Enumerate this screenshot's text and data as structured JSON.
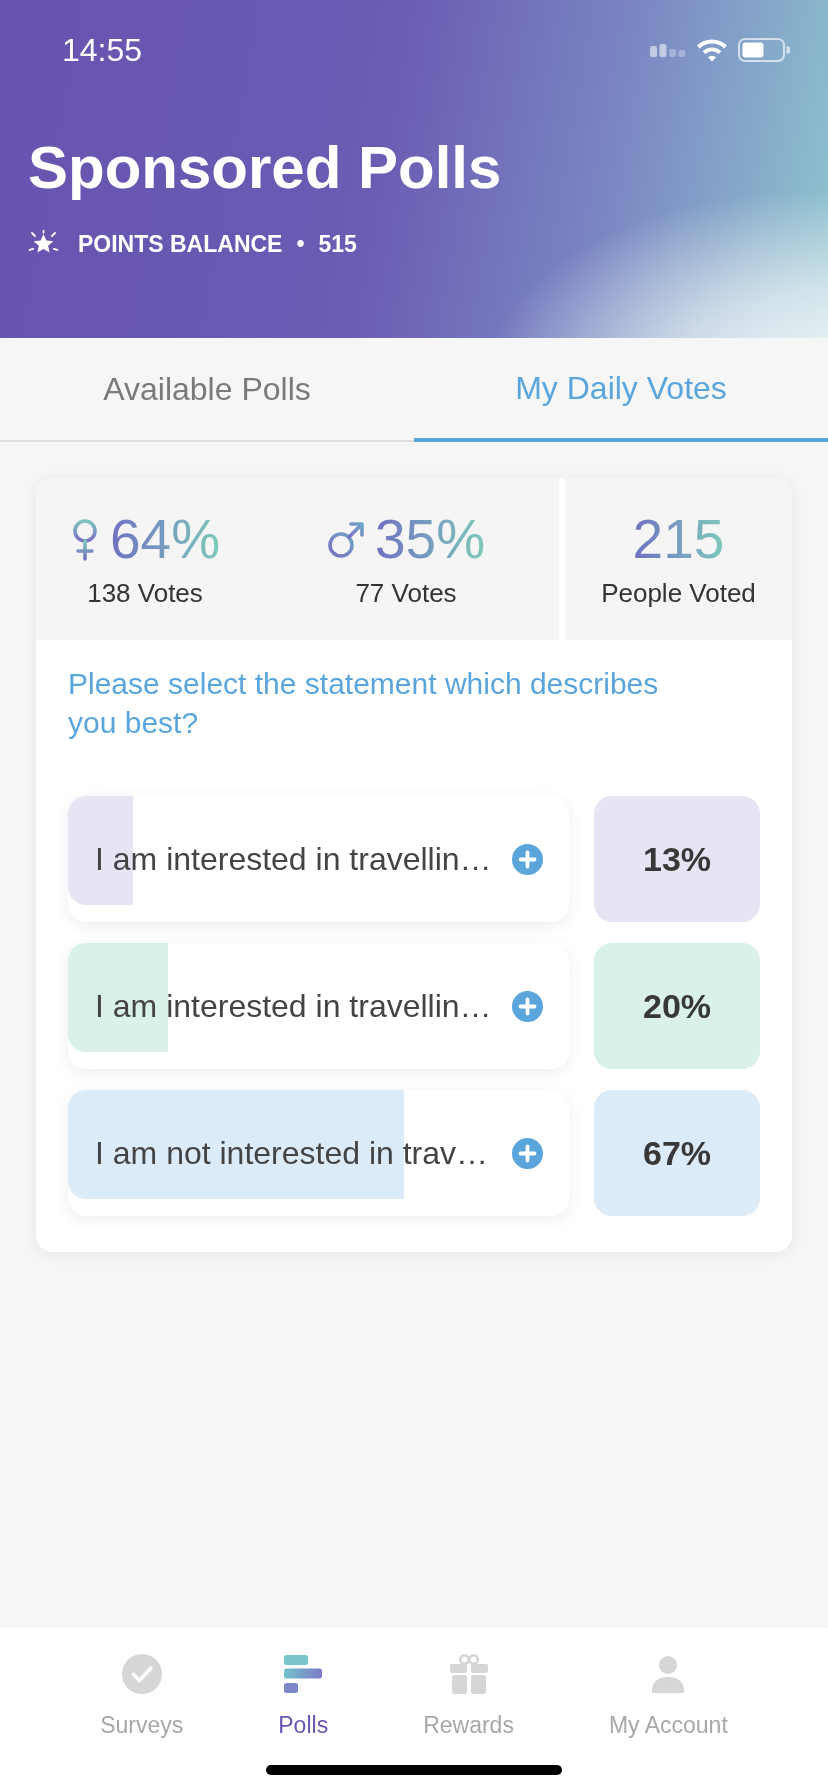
{
  "status_bar": {
    "time": "14:55"
  },
  "header": {
    "title": "Sponsored Polls",
    "points_label": "POINTS BALANCE",
    "separator": "•",
    "points": "515"
  },
  "tabs": [
    {
      "label": "Available Polls",
      "selected": false
    },
    {
      "label": "My Daily Votes",
      "selected": true
    }
  ],
  "stats": [
    {
      "kind": "female",
      "percent": "64%",
      "votes": "138 Votes"
    },
    {
      "kind": "male",
      "percent": "35%",
      "votes": "77 Votes"
    }
  ],
  "total": {
    "count": "215",
    "label": "People Voted"
  },
  "question": "Please select the statement which describes you best?",
  "options": [
    {
      "text": "I am interested in travellin…",
      "level": 0.13,
      "percent": "13%",
      "color": "#e7e4f4"
    },
    {
      "text": "I am interested in travellin…",
      "level": 0.2,
      "percent": "20%",
      "color": "#d9f1ea"
    },
    {
      "text": "I am not interested in trav…",
      "level": 0.67,
      "percent": "67%",
      "color": "#dcebf8"
    }
  ],
  "bottom_nav": [
    {
      "label": "Surveys",
      "selected": false
    },
    {
      "label": "Polls",
      "selected": true
    },
    {
      "label": "Rewards",
      "selected": false
    },
    {
      "label": "My Account",
      "selected": false
    }
  ]
}
